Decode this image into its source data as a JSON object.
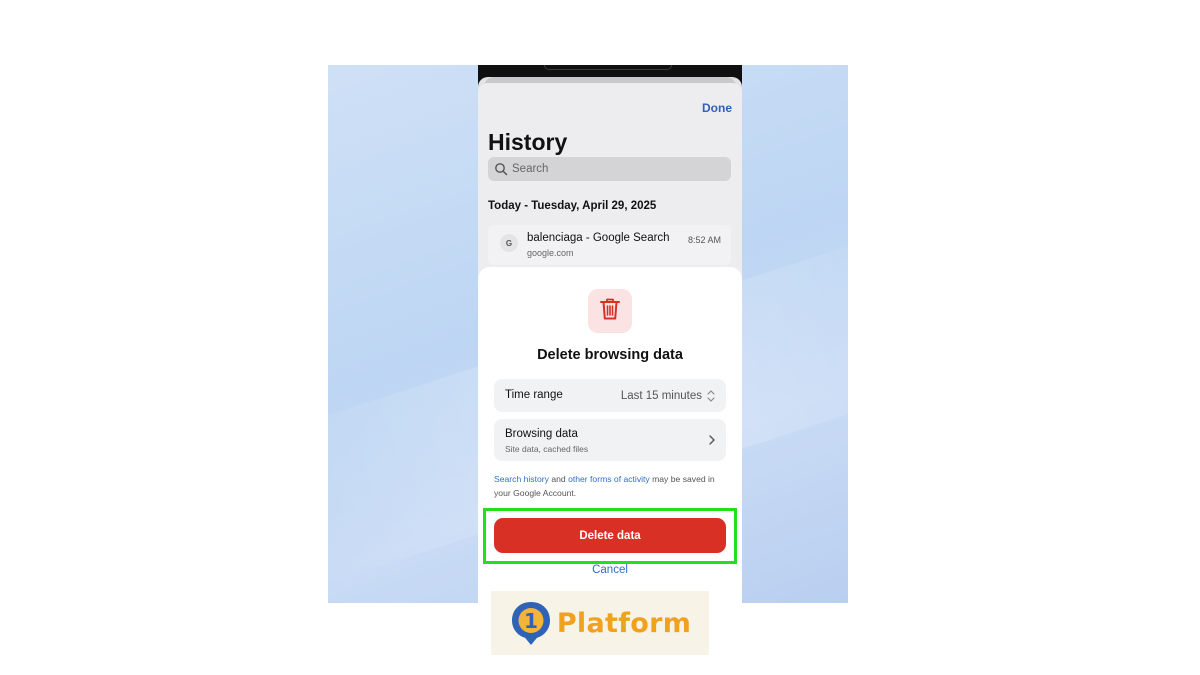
{
  "history": {
    "done_label": "Done",
    "title": "History",
    "search_placeholder": "Search",
    "date_header": "Today - Tuesday, April 29, 2025",
    "entries": [
      {
        "favicon_letter": "G",
        "title": "balenciaga - Google Search",
        "url": "google.com",
        "time": "8:52 AM"
      }
    ]
  },
  "dialog": {
    "icon": "trash-icon",
    "title": "Delete browsing data",
    "time_range": {
      "label": "Time range",
      "value": "Last 15 minutes"
    },
    "browsing_data": {
      "label": "Browsing data",
      "subtitle": "Site data, cached files"
    },
    "notice": {
      "link1": "Search history",
      "text1": " and ",
      "link2": "other forms of activity",
      "text2": " may be saved in your Google Account."
    },
    "delete_label": "Delete data",
    "cancel_label": "Cancel"
  },
  "colors": {
    "accent_blue": "#2f6ec8",
    "delete_red": "#d93025",
    "highlight_green": "#22e01c"
  },
  "watermark": {
    "logo_digit": "1",
    "logo_text": "Platform"
  }
}
